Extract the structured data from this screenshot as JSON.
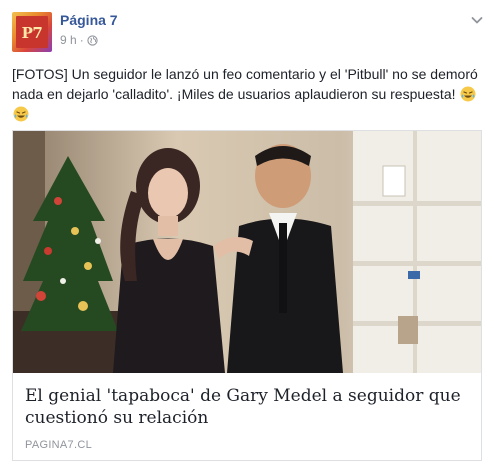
{
  "post": {
    "page_name": "Página 7",
    "avatar_text": "P7",
    "time": "9 h",
    "separator": "·",
    "text": "[FOTOS] Un seguidor le lanzó un feo comentario y el 'Pitbull' no se demoró nada en dejarlo 'calladito'. ¡Miles de usuarios aplaudieron su respuesta!"
  },
  "link": {
    "title": "El genial 'tapaboca' de Gary Medel a seguidor que cuestionó su relación",
    "domain": "PAGINA7.CL"
  },
  "icons": {
    "privacy": "globe-icon",
    "menu": "chevron-down-icon",
    "emoji": "laughing-tears-emoji"
  },
  "colors": {
    "page_name": "#365899",
    "meta": "#90949c",
    "text": "#1d2129",
    "border": "#dddfe2"
  }
}
